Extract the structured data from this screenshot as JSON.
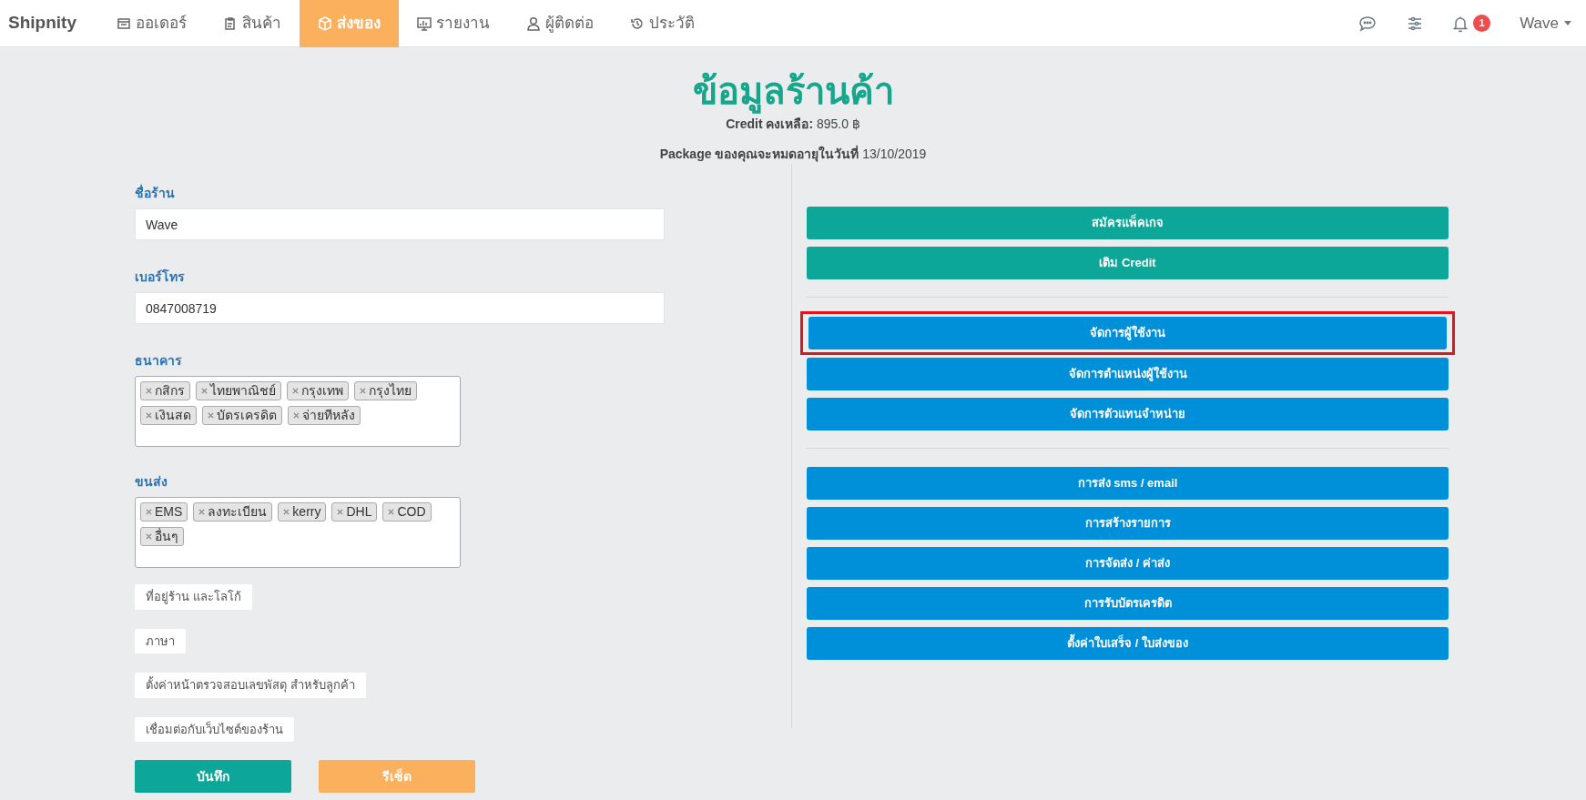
{
  "navbar": {
    "brand": "Shipnity",
    "items": [
      {
        "label": "ออเดอร์",
        "selected": false
      },
      {
        "label": "สินค้า",
        "selected": false
      },
      {
        "label": "ส่งของ",
        "selected": true
      },
      {
        "label": "รายงาน",
        "selected": false
      },
      {
        "label": "ผู้ติดต่อ",
        "selected": false
      },
      {
        "label": "ประวัติ",
        "selected": false
      }
    ],
    "notification_count": "1",
    "user": "Wave"
  },
  "header": {
    "title": "ข้อมูลร้านค้า",
    "credit_label": "Credit คงเหลือ:",
    "credit_value": "895.0 ฿",
    "package_label": "Package ของคุณจะหมดอายุในวันที่",
    "package_value": "13/10/2019"
  },
  "form": {
    "fields": [
      {
        "kind": "text",
        "label": "ชื่อร้าน",
        "value": "Wave"
      },
      {
        "kind": "text",
        "label": "เบอร์โทร",
        "value": "0847008719"
      },
      {
        "kind": "tags",
        "label": "ธนาคาร",
        "tags": [
          "กสิกร",
          "ไทยพาณิชย์",
          "กรุงเทพ",
          "กรุงไทย",
          "เงินสด",
          "บัตรเครดิต",
          "จ่ายทีหลัง"
        ]
      },
      {
        "kind": "tags",
        "label": "ขนส่ง",
        "tags": [
          "EMS",
          "ลงทะเบียน",
          "kerry",
          "DHL",
          "COD",
          "อื่นๆ"
        ]
      }
    ],
    "links": [
      "ที่อยู่ร้าน และโลโก้",
      "ภาษา",
      "ตั้งค่าหน้าตรวจสอบเลขพัสดุ สำหรับลูกค้า",
      "เชื่อมต่อกับเว็บไซต์ของร้าน"
    ],
    "actions": [
      {
        "kind": "save",
        "label": "บันทึก"
      },
      {
        "kind": "reset",
        "label": "รีเซ็ต"
      }
    ]
  },
  "settings": {
    "groups": [
      [
        {
          "kind": "teal",
          "label": "สมัครแพ็คเกจ",
          "highlighted": false
        },
        {
          "kind": "teal",
          "label": "เติม Credit",
          "highlighted": false
        }
      ],
      [
        {
          "kind": "blue",
          "label": "จัดการผู้ใช้งาน",
          "highlighted": true
        },
        {
          "kind": "blue",
          "label": "จัดการตำแหน่งผู้ใช้งาน",
          "highlighted": false
        },
        {
          "kind": "blue",
          "label": "จัดการตัวแทนจำหน่าย",
          "highlighted": false
        }
      ],
      [
        {
          "kind": "blue",
          "label": "การส่ง sms / email",
          "highlighted": false
        },
        {
          "kind": "blue",
          "label": "การสร้างรายการ",
          "highlighted": false
        },
        {
          "kind": "blue",
          "label": "การจัดส่ง / ค่าส่ง",
          "highlighted": false
        },
        {
          "kind": "blue",
          "label": "การรับบัตรเครดิต",
          "highlighted": false
        },
        {
          "kind": "blue",
          "label": "ตั้งค่าใบเสร็จ / ใบส่งของ",
          "highlighted": false
        }
      ]
    ]
  }
}
